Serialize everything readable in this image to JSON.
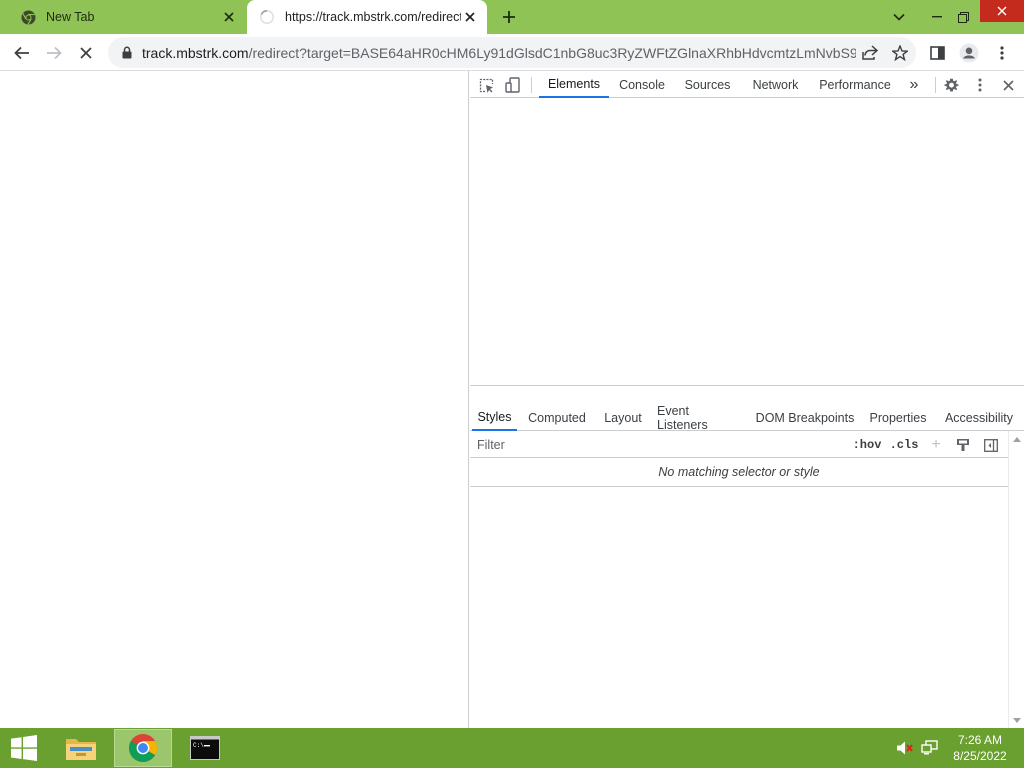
{
  "browser": {
    "tabs": [
      {
        "title": "New Tab",
        "active": false
      },
      {
        "title": "https://track.mbstrk.com/redirect",
        "active": true
      }
    ],
    "address_bar": {
      "host": "track.mbstrk.com",
      "path": "/redirect?target=BASE64aHR0cHM6Ly91dGlsdC1nbG8uc3RyZWFtZGlnaXRhbHdvcmtzLmNvbS9..."
    },
    "icons": {
      "back": "arrow-left-icon",
      "forward": "arrow-right-icon",
      "stop": "close-icon",
      "lock": "lock-icon",
      "share": "share-icon",
      "bookmark": "star-icon",
      "sidepanel": "side-panel-icon",
      "profile": "profile-icon",
      "menu": "more-vertical-icon"
    }
  },
  "devtools": {
    "main_tabs": [
      "Elements",
      "Console",
      "Sources",
      "Network",
      "Performance"
    ],
    "active_main_tab": "Elements",
    "overflow_label": "»",
    "sub_tabs": [
      "Styles",
      "Computed",
      "Layout",
      "Event Listeners",
      "DOM Breakpoints",
      "Properties",
      "Accessibility"
    ],
    "active_sub_tab": "Styles",
    "filter": {
      "placeholder": "Filter",
      "value": ""
    },
    "hov_label": ":hov",
    "cls_label": ".cls",
    "plus_label": "+",
    "empty_message": "No matching selector or style"
  },
  "taskbar": {
    "apps": [
      "file-explorer-icon",
      "chrome-icon",
      "command-prompt-icon"
    ],
    "active_app": "chrome-icon",
    "time": "7:26 AM",
    "date": "8/25/2022"
  },
  "colors": {
    "titlebar": "#8fc356",
    "taskbar": "#6aa02f",
    "accent": "#1a73e8",
    "close_red": "#c42b1c"
  }
}
